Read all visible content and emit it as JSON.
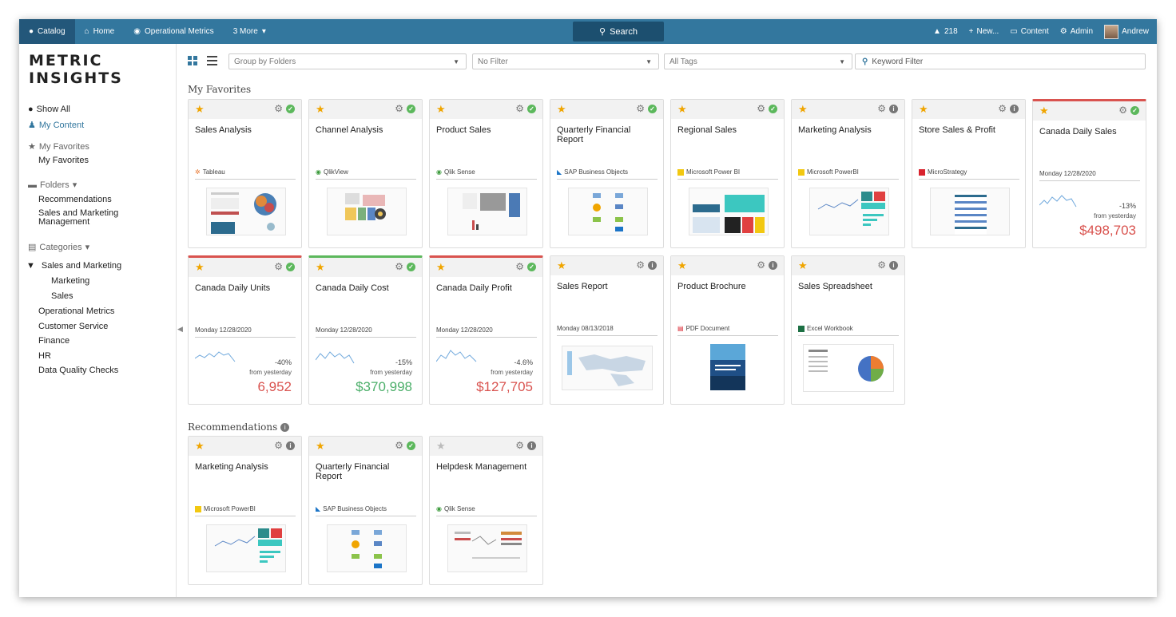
{
  "topnav": {
    "catalog": "Catalog",
    "home": "Home",
    "operational_metrics": "Operational Metrics",
    "more": "3 More",
    "search": "Search",
    "alerts_count": "218",
    "new": "New...",
    "content": "Content",
    "admin": "Admin",
    "user": "Andrew"
  },
  "logo": "METRIC INSIGHTS",
  "sidebar": {
    "show_all": "Show All",
    "my_content": "My Content",
    "favorites_header": "My Favorites",
    "favorites_item": "My Favorites",
    "folders_header": "Folders",
    "folders": [
      "Recommendations",
      "Sales and Marketing",
      "Management"
    ],
    "categories_header": "Categories",
    "categories": {
      "sales_marketing": "Sales and Marketing",
      "marketing": "Marketing",
      "sales": "Sales",
      "operational_metrics": "Operational Metrics",
      "customer_service": "Customer Service",
      "finance": "Finance",
      "hr": "HR",
      "data_quality": "Data Quality Checks"
    }
  },
  "toolbar": {
    "group_by": "Group by Folders",
    "filter": "No Filter",
    "tags": "All Tags",
    "keyword_placeholder": "Keyword Filter"
  },
  "sections": {
    "favorites": "My Favorites",
    "recommendations": "Recommendations"
  },
  "colors": {
    "nav": "#33779e",
    "nav_active": "#23577a",
    "star": "#f0a500",
    "ok": "#5cb85c",
    "alert_red": "#d9534f",
    "value_green": "#4caf6a"
  },
  "cards": {
    "c1": {
      "title": "Sales Analysis",
      "source": "Tableau"
    },
    "c2": {
      "title": "Channel Analysis",
      "source": "QlikView"
    },
    "c3": {
      "title": "Product Sales",
      "source": "Qlik Sense"
    },
    "c4": {
      "title": "Quarterly Financial Report",
      "source": "SAP Business Objects"
    },
    "c5": {
      "title": "Regional Sales",
      "source": "Microsoft Power BI"
    },
    "c6": {
      "title": "Marketing Analysis",
      "source": "Microsoft PowerBI"
    },
    "c7": {
      "title": "Store Sales & Profit",
      "source": "MicroStrategy"
    },
    "c8": {
      "title": "Canada Daily Sales",
      "date": "Monday 12/28/2020",
      "pct": "-13%",
      "from": "from yesterday",
      "value": "$498,703"
    },
    "c9": {
      "title": "Canada Daily Units",
      "date": "Monday 12/28/2020",
      "pct": "-40%",
      "from": "from yesterday",
      "value": "6,952"
    },
    "c10": {
      "title": "Canada Daily Cost",
      "date": "Monday 12/28/2020",
      "pct": "-15%",
      "from": "from yesterday",
      "value": "$370,998"
    },
    "c11": {
      "title": "Canada Daily Profit",
      "date": "Monday 12/28/2020",
      "pct": "-4.6%",
      "from": "from yesterday",
      "value": "$127,705"
    },
    "c12": {
      "title": "Sales Report",
      "date": "Monday 08/13/2018"
    },
    "c13": {
      "title": "Product Brochure",
      "source": "PDF Document"
    },
    "c14": {
      "title": "Sales Spreadsheet",
      "source": "Excel Workbook"
    },
    "r1": {
      "title": "Marketing Analysis",
      "source": "Microsoft PowerBI"
    },
    "r2": {
      "title": "Quarterly Financial Report",
      "source": "SAP Business Objects"
    },
    "r3": {
      "title": "Helpdesk Management",
      "source": "Qlik Sense"
    }
  }
}
